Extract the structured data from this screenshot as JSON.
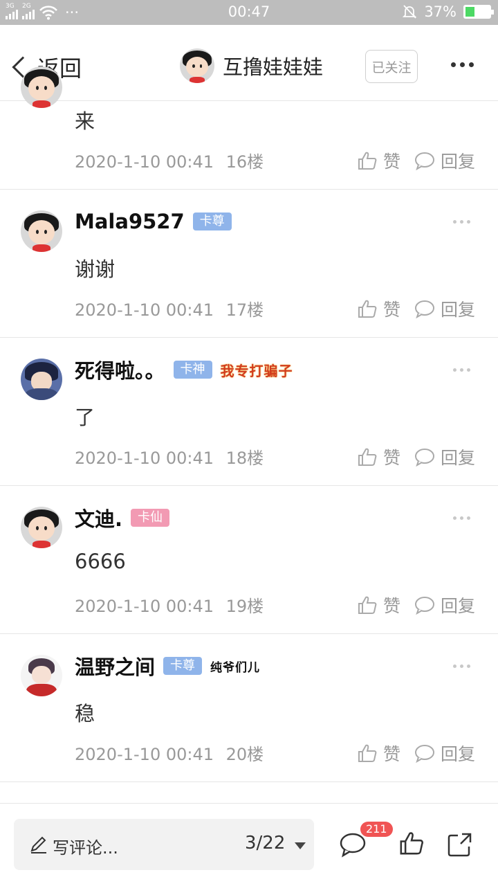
{
  "status_bar": {
    "network_1": "3G",
    "network_2": "2G",
    "more": "···",
    "time": "00:47",
    "battery_percent": "37%",
    "battery_level": 0.37
  },
  "header": {
    "back_label": "返回",
    "author_name": "互撸娃娃娃",
    "follow_label": "已关注"
  },
  "posts": [
    {
      "content": "来",
      "time": "2020-1-10 00:41",
      "floor": "16楼",
      "like_label": "赞",
      "reply_label": "回复"
    },
    {
      "username": "Mala9527",
      "badge": "卡尊",
      "content": "谢谢",
      "time": "2020-1-10 00:41",
      "floor": "17楼",
      "like_label": "赞",
      "reply_label": "回复"
    },
    {
      "username": "死得啦。。",
      "badge": "卡神",
      "title_tag": "我专打骗子",
      "content": "了",
      "time": "2020-1-10 00:41",
      "floor": "18楼",
      "like_label": "赞",
      "reply_label": "回复"
    },
    {
      "username": "文迪.",
      "badge": "卡仙",
      "content": "6666",
      "time": "2020-1-10 00:41",
      "floor": "19楼",
      "like_label": "赞",
      "reply_label": "回复"
    },
    {
      "username": "温野之间",
      "badge": "卡尊",
      "title_tag": "纯爷们儿",
      "content": "稳",
      "time": "2020-1-10 00:41",
      "floor": "20楼",
      "like_label": "赞",
      "reply_label": "回复"
    }
  ],
  "bottom_bar": {
    "comment_placeholder": "写评论...",
    "page_indicator": "3/22",
    "comment_count": "211"
  },
  "colors": {
    "badge_blue": "#8fb4ea",
    "badge_pink": "#f29ab3",
    "count_badge": "#f05454",
    "status_bar_bg": "#bdbdbd"
  }
}
